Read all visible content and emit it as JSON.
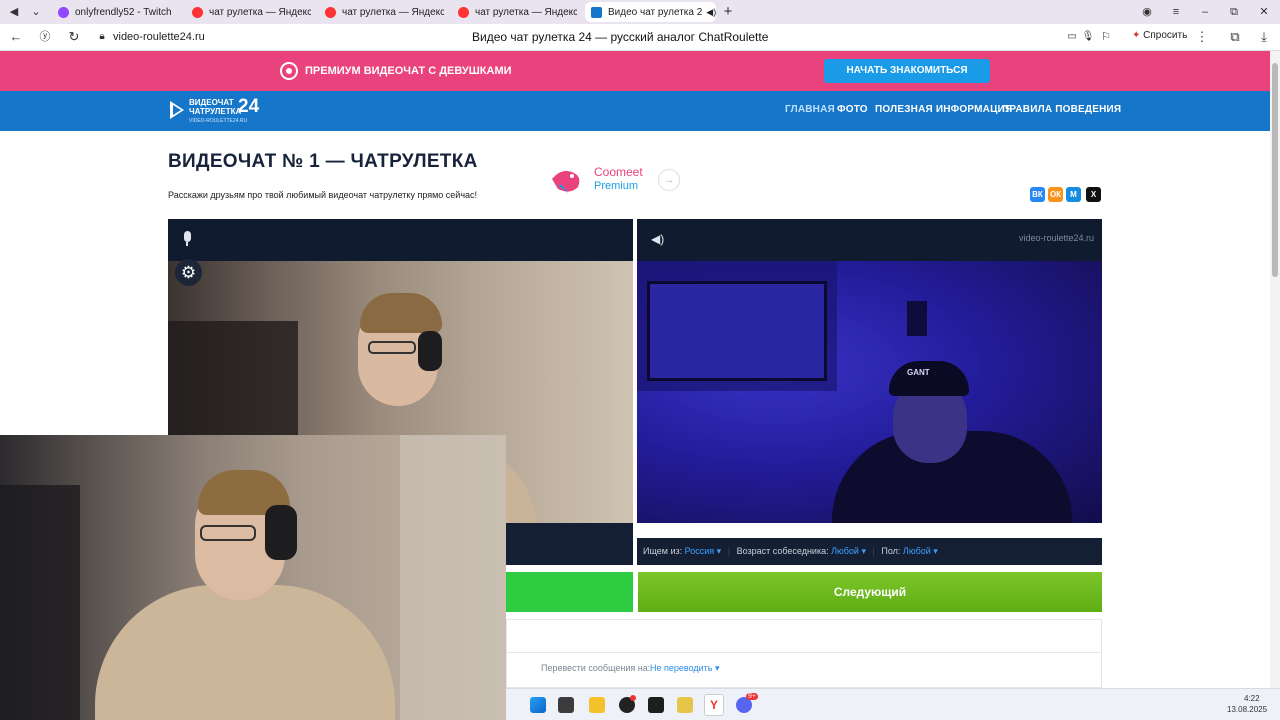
{
  "browser": {
    "tabs": [
      {
        "label": "onlyfrendly52 - Twitch"
      },
      {
        "label": "чат рулетка — Яндекс: на"
      },
      {
        "label": "чат рулетка — Яндекс: на"
      },
      {
        "label": "чат рулетка — Яндекс: на"
      },
      {
        "label": "Видео чат рулетка 2"
      }
    ],
    "url": "video-roulette24.ru",
    "page_title": "Видео чат рулетка 24 — русский аналог ChatRoulette",
    "ask_button": "Спросить"
  },
  "promo": {
    "text": "ПРЕМИУМ ВИДЕОЧАТ С ДЕВУШКАМИ",
    "cta": "НАЧАТЬ ЗНАКОМИТЬСЯ"
  },
  "site": {
    "logo_line1": "ВИДЕОЧАТ",
    "logo_line2": "ЧАТРУЛЕТКА",
    "logo_num": "24",
    "logo_sub": "VIDEO-ROULETTE24.RU",
    "nav": [
      "ГЛАВНАЯ",
      "ФОТО",
      "ПОЛЕЗНАЯ ИНФОРМАЦИЯ",
      "ПРАВИЛА ПОВЕДЕНИЯ"
    ]
  },
  "main": {
    "heading": "ВИДЕОЧАТ № 1 — ЧАТРУЛЕТКА",
    "subtext": "Расскажи друзьям про твой любимый видеочат чатрулетку прямо сейчас!",
    "ad_brand": "Coomeet",
    "ad_sub": "Premium",
    "share": [
      "ВК",
      "ОК",
      "М",
      "X"
    ]
  },
  "remote": {
    "watermark": "video-roulette24.ru",
    "filter_country_label": "Ищем из:",
    "filter_country_value": "Россия",
    "filter_age_label": "Возраст собеседника:",
    "filter_age_value": "Любой",
    "filter_sex_label": "Пол:",
    "filter_sex_value": "Любой"
  },
  "controls": {
    "next_button": "Следующий"
  },
  "chat": {
    "translate_label": "Перевести сообщения на:",
    "translate_value": "Не переводить"
  },
  "system": {
    "time": "4:22",
    "date": "13.08.2025",
    "badge": "9+"
  },
  "colors": {
    "promo_pink": "#e9427d",
    "nav_blue": "#1676c9",
    "cta_blue": "#1a9be8",
    "start_green": "#2ecc40",
    "next_green": "#69bc1c",
    "link_blue": "#3ea0ff"
  }
}
